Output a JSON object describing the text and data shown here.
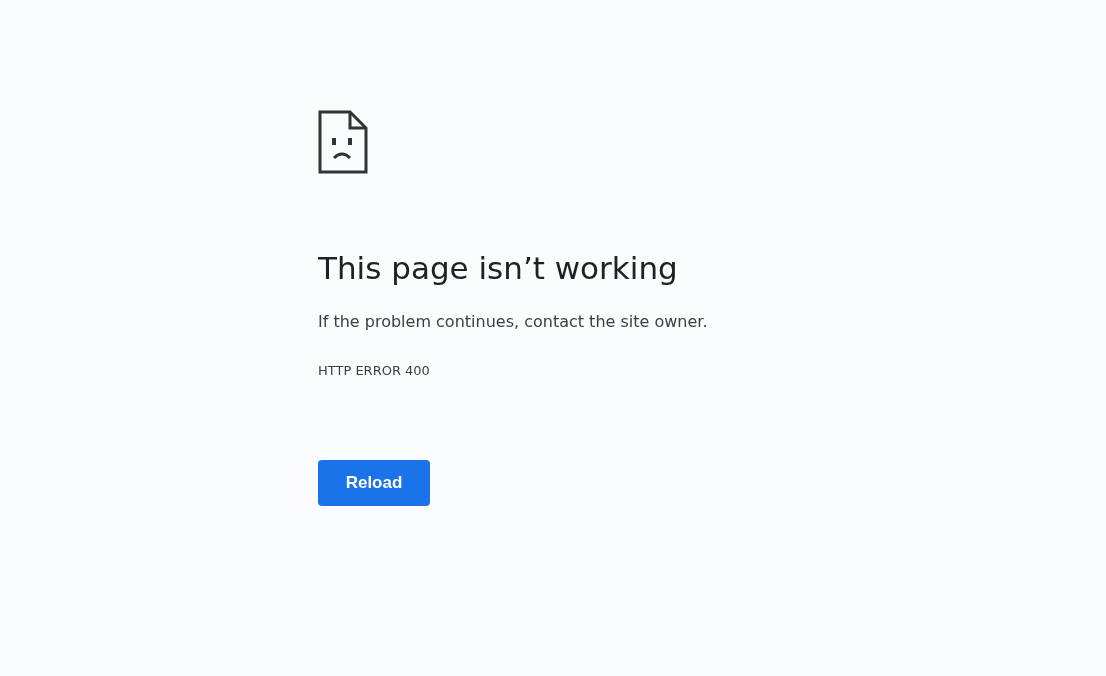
{
  "error_page": {
    "heading": "This page isn’t working",
    "message": "If the problem continues, contact the site owner.",
    "error_code": "HTTP ERROR 400",
    "button": "Reload"
  }
}
